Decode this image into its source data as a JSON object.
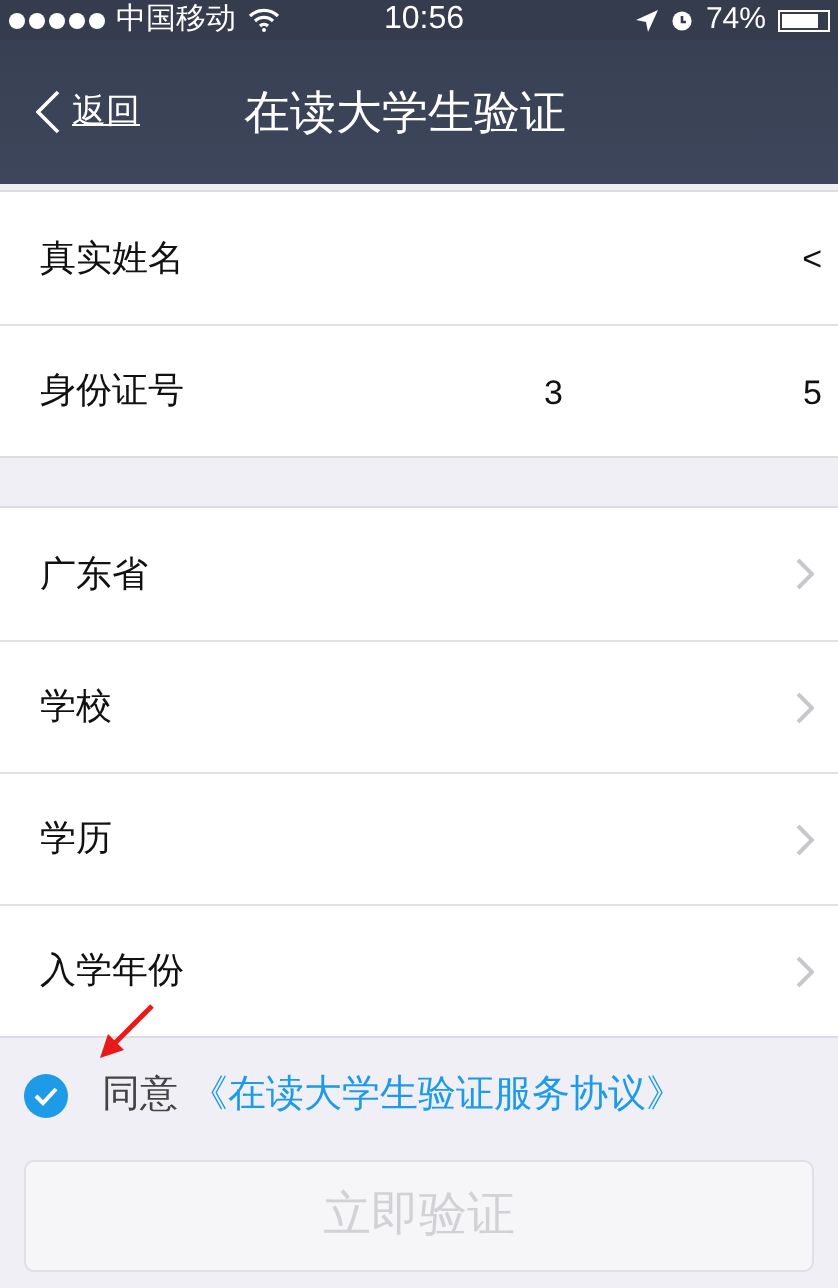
{
  "status_bar": {
    "carrier": "中国移动",
    "time": "10:56",
    "battery": "74%"
  },
  "nav": {
    "back": "返回",
    "title": "在读大学生验证"
  },
  "groups": [
    {
      "rows": [
        {
          "kind": "field",
          "label": "真实姓名",
          "value_fragments": [
            "<"
          ]
        },
        {
          "kind": "field",
          "label": "身份证号",
          "value_fragments": [
            "3",
            "5"
          ]
        }
      ]
    },
    {
      "rows": [
        {
          "kind": "picker",
          "label": "广东省"
        },
        {
          "kind": "picker",
          "label": "学校"
        },
        {
          "kind": "picker",
          "label": "学历"
        },
        {
          "kind": "picker",
          "label": "入学年份"
        }
      ]
    }
  ],
  "agreement": {
    "checked": true,
    "text": "同意",
    "link": "《在读大学生验证服务协议》"
  },
  "submit": {
    "label": "立即验证",
    "disabled": true
  }
}
